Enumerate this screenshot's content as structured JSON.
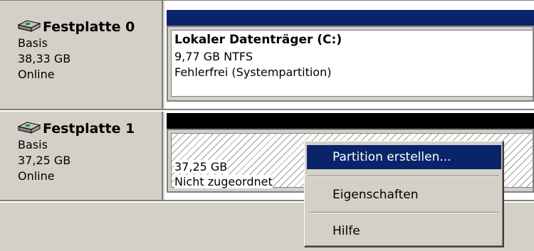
{
  "disks": [
    {
      "name": "Festplatte 0",
      "type": "Basis",
      "size": "38,33 GB",
      "status": "Online",
      "volume": {
        "title": "Lokaler Datenträger  (C:)",
        "detail": "9,77 GB NTFS",
        "status": "Fehlerfrei (Systempartition)"
      }
    },
    {
      "name": "Festplatte 1",
      "type": "Basis",
      "size": "37,25 GB",
      "status": "Online",
      "volume": {
        "detail": "37,25 GB",
        "status": "Nicht zugeordnet"
      }
    }
  ],
  "context_menu": {
    "items": [
      "Partition erstellen...",
      "Eigenschaften",
      "Hilfe"
    ],
    "selected_index": 0
  },
  "colors": {
    "primary_partition_bar": "#0a246a",
    "unallocated_bar": "#000000",
    "menu_highlight": "#0a246a",
    "window_background": "#d4d0c8"
  }
}
